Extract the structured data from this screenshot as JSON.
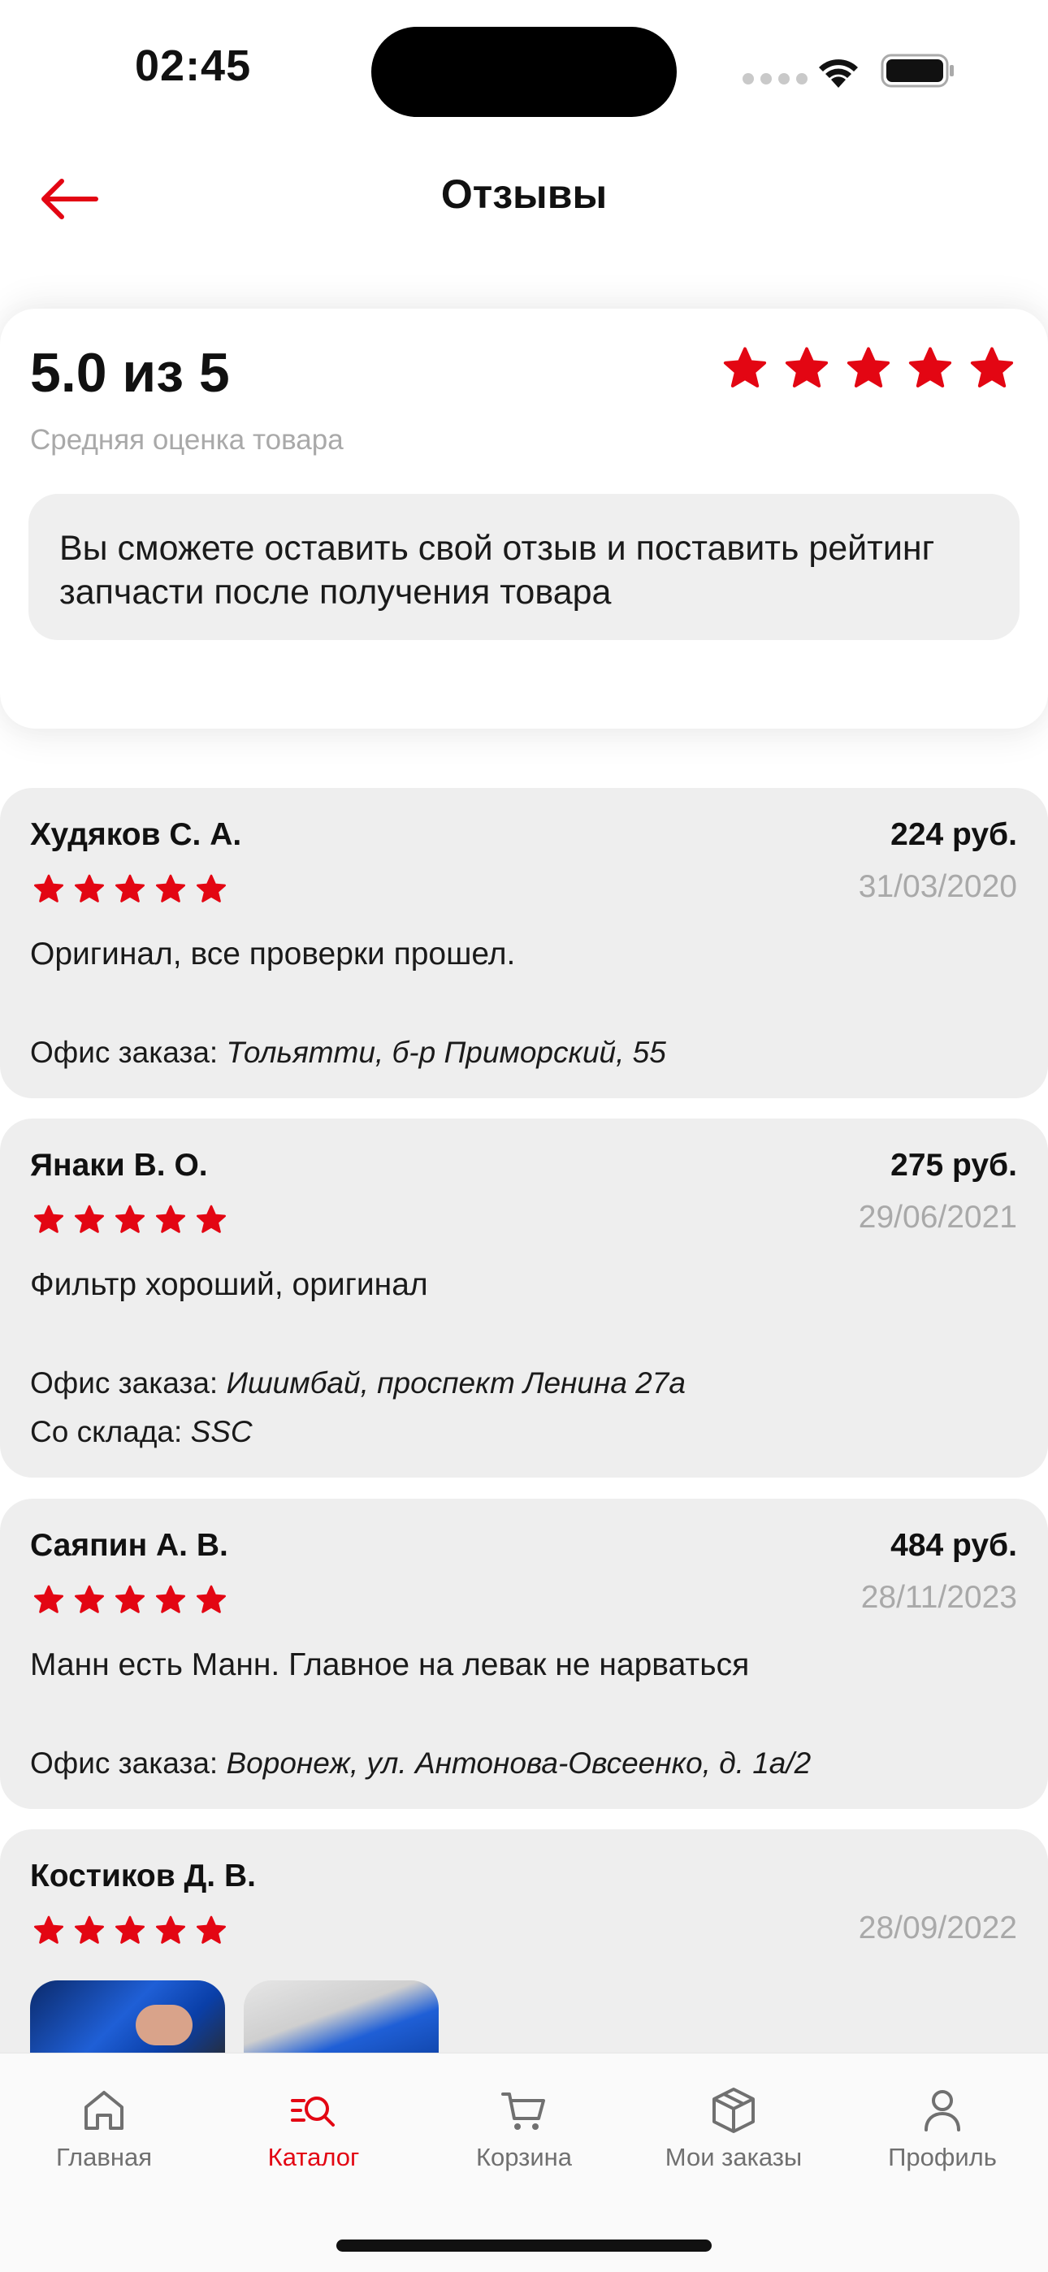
{
  "status_bar": {
    "time": "02:45"
  },
  "header": {
    "title": "Отзывы"
  },
  "summary": {
    "score": "5.0 из 5",
    "rating": 5,
    "subtitle": "Средняя оценка товара",
    "info": "Вы сможете оставить свой отзыв и поставить рейтинг запчасти после получения товара"
  },
  "reviews": [
    {
      "name": "Худяков С. А.",
      "price": "224 руб.",
      "date": "31/03/2020",
      "rating": 5,
      "text": "Оригинал, все проверки прошел.",
      "office_label": "Офис заказа:",
      "office": "Тольятти, б-р Приморский, 55"
    },
    {
      "name": "Янаки В. О.",
      "price": "275 руб.",
      "date": "29/06/2021",
      "rating": 5,
      "text": "Фильтр хороший, оригинал",
      "office_label": "Офис заказа:",
      "office": "Ишимбай, проспект Ленина 27а",
      "warehouse_label": "Со склада:",
      "warehouse": "SSC"
    },
    {
      "name": "Саяпин А. В.",
      "price": "484 руб.",
      "date": "28/11/2023",
      "rating": 5,
      "text": "Манн есть Манн. Главное на левак не нарваться",
      "office_label": "Офис заказа:",
      "office": "Воронеж, ул. Антонова-Овсеенко, д. 1а/2"
    },
    {
      "name": "Костиков Д. В.",
      "date": "28/09/2022",
      "rating": 5
    }
  ],
  "tabbar": {
    "items": [
      {
        "label": "Главная",
        "icon": "home-icon"
      },
      {
        "label": "Каталог",
        "icon": "catalog-search-icon",
        "active": true
      },
      {
        "label": "Корзина",
        "icon": "cart-icon"
      },
      {
        "label": "Мои заказы",
        "icon": "package-icon"
      },
      {
        "label": "Профиль",
        "icon": "profile-icon"
      }
    ]
  },
  "colors": {
    "accent": "#e30613",
    "card": "#eeeeee",
    "muted": "#a9a9a9"
  }
}
